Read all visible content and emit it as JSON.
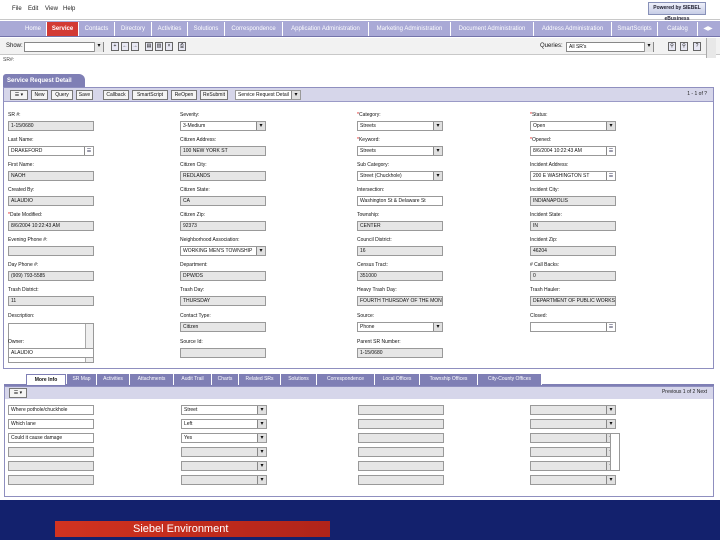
{
  "menu": [
    "File",
    "Edit",
    "View",
    "Help"
  ],
  "logo_text": "Powered by SIEBEL eBusiness",
  "tabs": [
    "Home",
    "Service",
    "Contacts",
    "Directory",
    "Activities",
    "Solutions",
    "Correspondence",
    "Application Administration",
    "Marketing Administration",
    "Document Administration",
    "Address Administration",
    "SmartScripts",
    "Catalog"
  ],
  "showbar": {
    "show_label": "Show:",
    "queries_label": "Queries:",
    "queries_value": "All SR's"
  },
  "sr_hash": "SR#:",
  "applet": {
    "title": "Service Request Detail",
    "menu_btn": "☰ ▾",
    "buttons": [
      "New",
      "Query",
      "Save",
      "Callback",
      "SmartScript",
      "ReOpen",
      "ReSubmit"
    ],
    "view_select": "Service Request Detail",
    "pager": "1 - 1 of ?"
  },
  "fields": [
    {
      "label": "SR #:",
      "value": "1-15/0680",
      "req": false
    },
    {
      "label": "Severity:",
      "value": "3-Medium",
      "req": false
    },
    {
      "label": "Category:",
      "value": "Streets",
      "req": true
    },
    {
      "label": "Status:",
      "value": "Open",
      "req": true
    },
    {
      "label": "Last Name:",
      "value": "DRAKEFORD",
      "req": false
    },
    {
      "label": "Citizen Address:",
      "value": "100 NEW YORK ST",
      "req": false
    },
    {
      "label": "Keyword:",
      "value": "Streets",
      "req": true
    },
    {
      "label": "Opened:",
      "value": "8/6/2004 10:22:43 AM",
      "req": true
    },
    {
      "label": "First Name:",
      "value": "NAOH",
      "req": false
    },
    {
      "label": "Citizen City:",
      "value": "REDLANDS",
      "req": false
    },
    {
      "label": "Sub Category:",
      "value": "Street (Chuckhole)",
      "req": false
    },
    {
      "label": "Incident Address:",
      "value": "200 E WASHINGTON ST",
      "req": false
    },
    {
      "label": "Created By:",
      "value": "ALAUDIO",
      "req": false
    },
    {
      "label": "Citizen State:",
      "value": "CA",
      "req": false
    },
    {
      "label": "Intersection:",
      "value": "Washington St & Delaware St",
      "req": false
    },
    {
      "label": "Incident City:",
      "value": "INDIANAPOLIS",
      "req": false
    },
    {
      "label": "Date Modified:",
      "value": "8/6/2004 10:22:43 AM",
      "req": true
    },
    {
      "label": "Citizen Zip:",
      "value": "92373",
      "req": false
    },
    {
      "label": "Township:",
      "value": "CENTER",
      "req": false
    },
    {
      "label": "Incident State:",
      "value": "IN",
      "req": false
    },
    {
      "label": "Evening Phone #:",
      "value": "",
      "req": false
    },
    {
      "label": "Neighborhood Association:",
      "value": "WORKING MEN'S TOWNSHIP",
      "req": false
    },
    {
      "label": "Council District:",
      "value": "16",
      "req": false
    },
    {
      "label": "Incident Zip:",
      "value": "46204",
      "req": false
    },
    {
      "label": "Day Phone #:",
      "value": "(909) 793-5585",
      "req": false
    },
    {
      "label": "Department:",
      "value": "DPW/DS",
      "req": false
    },
    {
      "label": "Census Tract:",
      "value": "351000",
      "req": false
    },
    {
      "label": "# Call Backs:",
      "value": "0",
      "req": false
    },
    {
      "label": "Trash District:",
      "value": "11",
      "req": false
    },
    {
      "label": "Trash Day:",
      "value": "THURSDAY",
      "req": false
    },
    {
      "label": "Heavy Trash Day:",
      "value": "FOURTH THURSDAY OF THE MONTH",
      "req": false
    },
    {
      "label": "Trash Hauler:",
      "value": "DEPARTMENT OF PUBLIC WORKS",
      "req": false
    },
    {
      "label": "Description:",
      "value": "",
      "req": false
    },
    {
      "label": "Contact Type:",
      "value": "Citizen",
      "req": false
    },
    {
      "label": "Source:",
      "value": "Phone",
      "req": false
    },
    {
      "label": "Closed:",
      "value": "",
      "req": false
    },
    {
      "label": "Owner:",
      "value": "ALAUDIO",
      "req": false
    },
    {
      "label": "Source Id:",
      "value": "",
      "req": false
    },
    {
      "label": "Parent SR Number:",
      "value": "1-15/0680",
      "req": false
    }
  ],
  "bottom_tabs": [
    "More Info",
    "SR Map",
    "Activities",
    "Attachments",
    "Audit Trail",
    "Charts",
    "Related SRs",
    "Solutions",
    "Correspondence",
    "Local Offices",
    "Township Offices",
    "City-County Offices"
  ],
  "list": {
    "pager": "Previous 1 of 2 Next",
    "rows": [
      [
        "Where pothole/chuckhole",
        "Street"
      ],
      [
        "Which lane",
        "Left"
      ],
      [
        "Could it cause damage",
        "Yes"
      ],
      [
        "",
        ""
      ],
      [
        "",
        ""
      ],
      [
        "",
        ""
      ]
    ]
  },
  "footer_text": "Siebel Environment"
}
